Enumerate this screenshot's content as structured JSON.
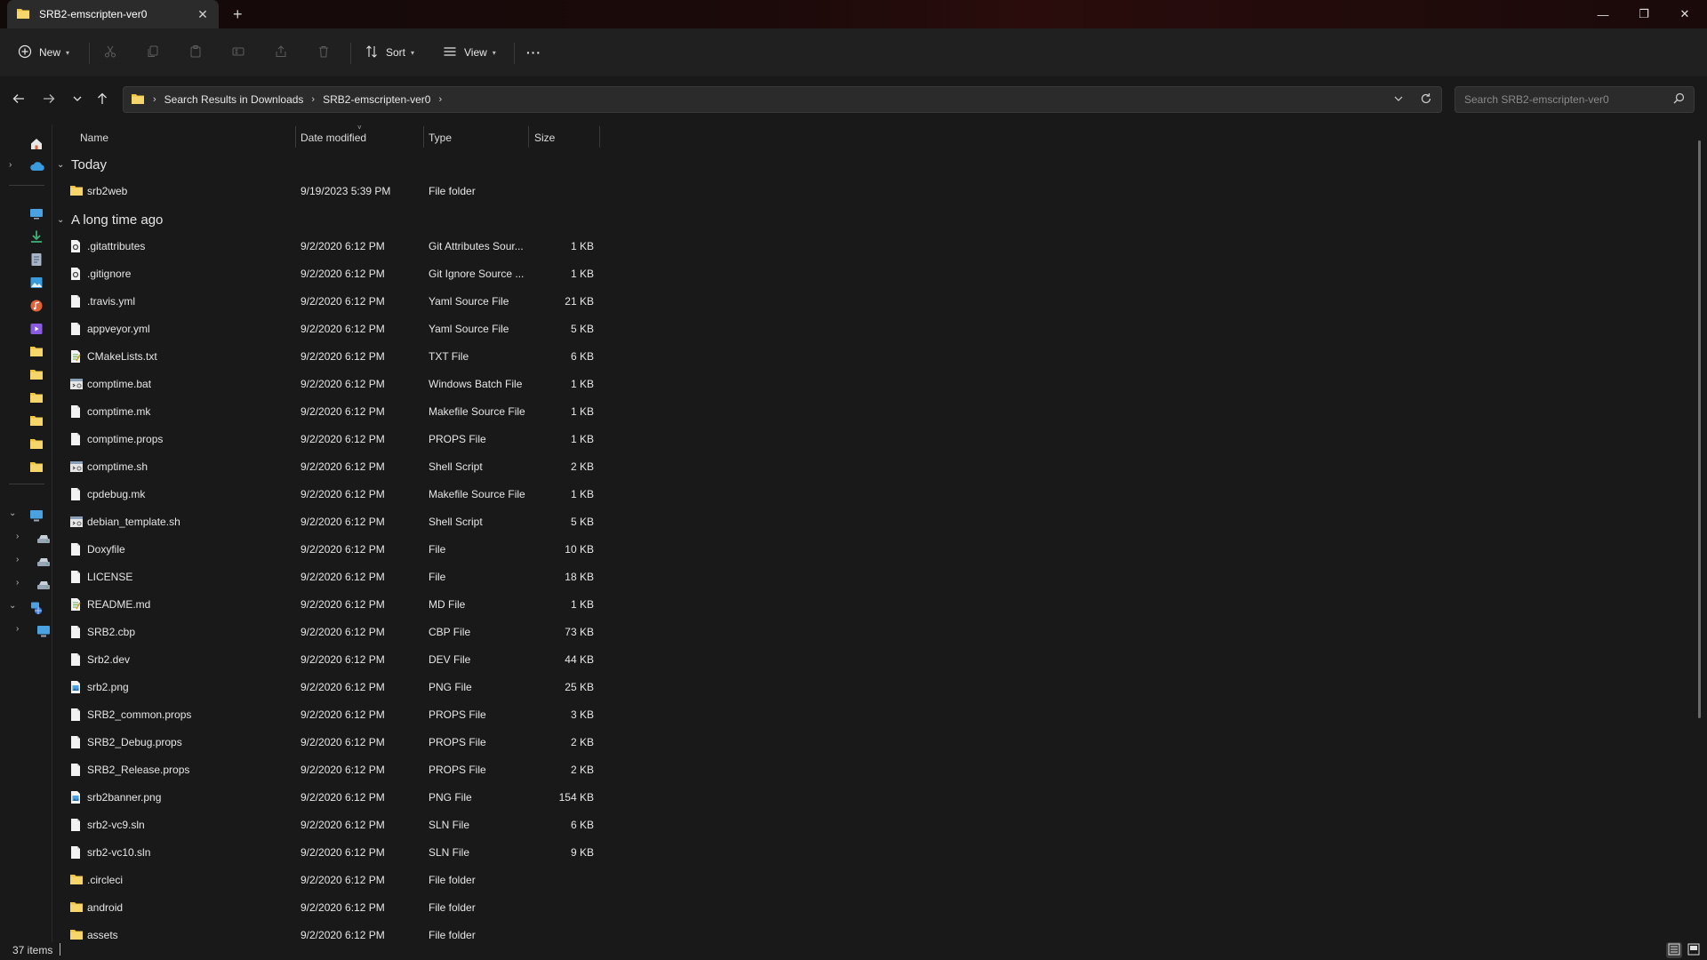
{
  "window": {
    "tab_title": "SRB2-emscripten-ver0",
    "tab_close": "✕",
    "new_tab": "+",
    "minimize": "—",
    "restore": "❐",
    "close": "✕"
  },
  "toolbar": {
    "new_label": "New",
    "sort_label": "Sort",
    "view_label": "View",
    "more_label": "···"
  },
  "address": {
    "crumbs": [
      "Search Results in Downloads",
      "SRB2-emscripten-ver0"
    ],
    "search_placeholder": "Search SRB2-emscripten-ver0"
  },
  "columns": {
    "name": "Name",
    "date": "Date modified",
    "type": "Type",
    "size": "Size"
  },
  "groups": [
    {
      "label": "Today",
      "files": [
        {
          "name": "srb2web",
          "date": "9/19/2023 5:39 PM",
          "type": "File folder",
          "size": "",
          "icon": "folder-icon"
        }
      ]
    },
    {
      "label": "A long time ago",
      "files": [
        {
          "name": ".gitattributes",
          "date": "9/2/2020 6:12 PM",
          "type": "Git Attributes Sour...",
          "size": "1 KB",
          "icon": "gear-file-icon"
        },
        {
          "name": ".gitignore",
          "date": "9/2/2020 6:12 PM",
          "type": "Git Ignore Source ...",
          "size": "1 KB",
          "icon": "gear-file-icon"
        },
        {
          "name": ".travis.yml",
          "date": "9/2/2020 6:12 PM",
          "type": "Yaml Source File",
          "size": "21 KB",
          "icon": "file-icon"
        },
        {
          "name": "appveyor.yml",
          "date": "9/2/2020 6:12 PM",
          "type": "Yaml Source File",
          "size": "5 KB",
          "icon": "file-icon"
        },
        {
          "name": "CMakeLists.txt",
          "date": "9/2/2020 6:12 PM",
          "type": "TXT File",
          "size": "6 KB",
          "icon": "text-file-icon"
        },
        {
          "name": "comptime.bat",
          "date": "9/2/2020 6:12 PM",
          "type": "Windows Batch File",
          "size": "1 KB",
          "icon": "script-file-icon"
        },
        {
          "name": "comptime.mk",
          "date": "9/2/2020 6:12 PM",
          "type": "Makefile Source File",
          "size": "1 KB",
          "icon": "file-icon"
        },
        {
          "name": "comptime.props",
          "date": "9/2/2020 6:12 PM",
          "type": "PROPS File",
          "size": "1 KB",
          "icon": "file-icon"
        },
        {
          "name": "comptime.sh",
          "date": "9/2/2020 6:12 PM",
          "type": "Shell Script",
          "size": "2 KB",
          "icon": "script-file-icon"
        },
        {
          "name": "cpdebug.mk",
          "date": "9/2/2020 6:12 PM",
          "type": "Makefile Source File",
          "size": "1 KB",
          "icon": "file-icon"
        },
        {
          "name": "debian_template.sh",
          "date": "9/2/2020 6:12 PM",
          "type": "Shell Script",
          "size": "5 KB",
          "icon": "script-file-icon"
        },
        {
          "name": "Doxyfile",
          "date": "9/2/2020 6:12 PM",
          "type": "File",
          "size": "10 KB",
          "icon": "file-icon"
        },
        {
          "name": "LICENSE",
          "date": "9/2/2020 6:12 PM",
          "type": "File",
          "size": "18 KB",
          "icon": "file-icon"
        },
        {
          "name": "README.md",
          "date": "9/2/2020 6:12 PM",
          "type": "MD File",
          "size": "1 KB",
          "icon": "text-file-icon"
        },
        {
          "name": "SRB2.cbp",
          "date": "9/2/2020 6:12 PM",
          "type": "CBP File",
          "size": "73 KB",
          "icon": "file-icon"
        },
        {
          "name": "Srb2.dev",
          "date": "9/2/2020 6:12 PM",
          "type": "DEV File",
          "size": "44 KB",
          "icon": "file-icon"
        },
        {
          "name": "srb2.png",
          "date": "9/2/2020 6:12 PM",
          "type": "PNG File",
          "size": "25 KB",
          "icon": "image-file-icon"
        },
        {
          "name": "SRB2_common.props",
          "date": "9/2/2020 6:12 PM",
          "type": "PROPS File",
          "size": "3 KB",
          "icon": "file-icon"
        },
        {
          "name": "SRB2_Debug.props",
          "date": "9/2/2020 6:12 PM",
          "type": "PROPS File",
          "size": "2 KB",
          "icon": "file-icon"
        },
        {
          "name": "SRB2_Release.props",
          "date": "9/2/2020 6:12 PM",
          "type": "PROPS File",
          "size": "2 KB",
          "icon": "file-icon"
        },
        {
          "name": "srb2banner.png",
          "date": "9/2/2020 6:12 PM",
          "type": "PNG File",
          "size": "154 KB",
          "icon": "image-file-icon"
        },
        {
          "name": "srb2-vc9.sln",
          "date": "9/2/2020 6:12 PM",
          "type": "SLN File",
          "size": "6 KB",
          "icon": "file-icon"
        },
        {
          "name": "srb2-vc10.sln",
          "date": "9/2/2020 6:12 PM",
          "type": "SLN File",
          "size": "9 KB",
          "icon": "file-icon"
        },
        {
          "name": ".circleci",
          "date": "9/2/2020 6:12 PM",
          "type": "File folder",
          "size": "",
          "icon": "folder-icon"
        },
        {
          "name": "android",
          "date": "9/2/2020 6:12 PM",
          "type": "File folder",
          "size": "",
          "icon": "folder-icon"
        },
        {
          "name": "assets",
          "date": "9/2/2020 6:12 PM",
          "type": "File folder",
          "size": "",
          "icon": "folder-icon"
        }
      ]
    }
  ],
  "nav_pane": [
    {
      "icon": "home-icon",
      "expander": "",
      "color": "#e8e8e8"
    },
    {
      "icon": "cloud-icon",
      "expander": "›",
      "color": "#3a9bdc"
    },
    {
      "icon": "desktop-icon",
      "expander": "",
      "color": "#4aa3e0"
    },
    {
      "icon": "downloads-icon",
      "expander": "",
      "color": "#3bb27a"
    },
    {
      "icon": "documents-icon",
      "expander": "",
      "color": "#a9b6c8"
    },
    {
      "icon": "pictures-icon",
      "expander": "",
      "color": "#3a9bdc"
    },
    {
      "icon": "music-icon",
      "expander": "",
      "color": "#e0623a"
    },
    {
      "icon": "videos-icon",
      "expander": "",
      "color": "#8a5be0"
    },
    {
      "icon": "folder-icon",
      "expander": "",
      "color": "#f0c545"
    },
    {
      "icon": "folder-icon",
      "expander": "",
      "color": "#f0c545"
    },
    {
      "icon": "folder-icon",
      "expander": "",
      "color": "#f0c545"
    },
    {
      "icon": "folder-icon",
      "expander": "",
      "color": "#f0c545"
    },
    {
      "icon": "folder-icon",
      "expander": "",
      "color": "#f0c545"
    },
    {
      "icon": "folder-icon",
      "expander": "",
      "color": "#f0c545"
    },
    {
      "icon": "this-pc-icon",
      "expander": "⌄",
      "color": "#4aa3e0"
    },
    {
      "icon": "drive-icon",
      "expander": "›",
      "color": "#9aa6b5"
    },
    {
      "icon": "drive-icon",
      "expander": "›",
      "color": "#9aa6b5"
    },
    {
      "icon": "drive-icon",
      "expander": "›",
      "color": "#9aa6b5"
    },
    {
      "icon": "network-icon",
      "expander": "⌄",
      "color": "#4aa3e0"
    },
    {
      "icon": "network-pc-icon",
      "expander": "›",
      "color": "#4aa3e0"
    }
  ],
  "status": {
    "item_count": "37 items"
  },
  "colors": {
    "folder": "#f0c545",
    "accent": "#4aa3e0"
  }
}
